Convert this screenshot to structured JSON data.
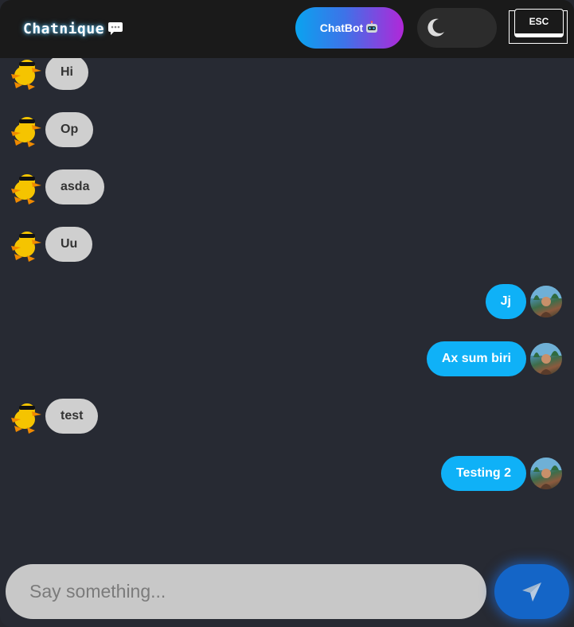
{
  "header": {
    "brand": "Chatnique",
    "brand_icon": "speech-bubble-icon",
    "chatbot_label": "ChatBot",
    "chatbot_icon": "robot-icon",
    "theme_toggle_icon": "moon-icon",
    "esc_label": "ESC"
  },
  "messages": [
    {
      "side": "left",
      "avatar": "duck-avatar",
      "text": "Hi"
    },
    {
      "side": "left",
      "avatar": "duck-avatar",
      "text": "Op"
    },
    {
      "side": "left",
      "avatar": "duck-avatar",
      "text": "asda"
    },
    {
      "side": "left",
      "avatar": "duck-avatar",
      "text": "Uu"
    },
    {
      "side": "right",
      "avatar": "user-photo-avatar",
      "text": "Jj"
    },
    {
      "side": "right",
      "avatar": "user-photo-avatar",
      "text": "Ax sum biri"
    },
    {
      "side": "left",
      "avatar": "duck-avatar",
      "text": "test"
    },
    {
      "side": "right",
      "avatar": "user-photo-avatar",
      "text": "Testing 2"
    }
  ],
  "composer": {
    "placeholder": "Say something...",
    "value": "",
    "send_icon": "send-icon"
  },
  "colors": {
    "background": "#272a33",
    "header": "#1a1a1a",
    "incoming_bubble": "#cfcfcf",
    "outgoing_bubble": "#0fb1f7",
    "send_button": "#1465c7"
  }
}
